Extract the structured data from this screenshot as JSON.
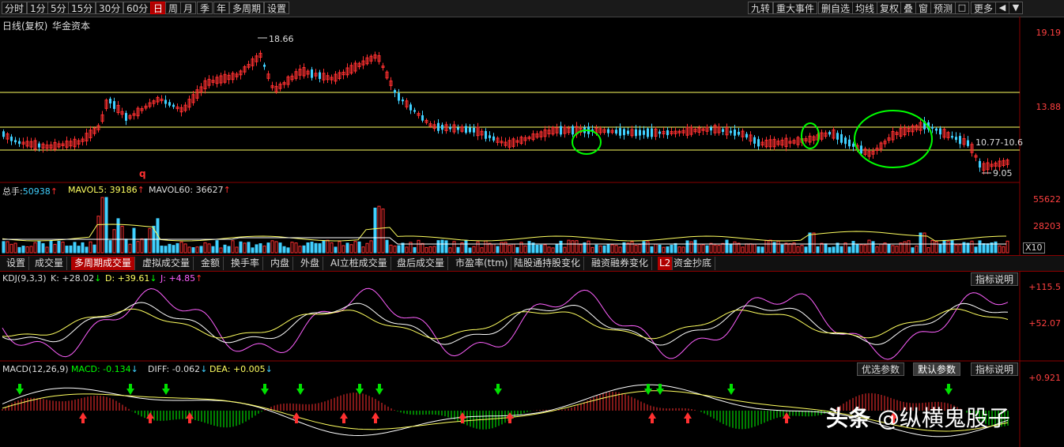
{
  "toolbar": {
    "left": [
      "分时",
      "1分",
      "5分",
      "15分",
      "30分",
      "60分",
      "日",
      "周",
      "月",
      "季",
      "年",
      "多周期",
      "设置"
    ],
    "active": "日",
    "right": [
      "九转",
      "重大事件",
      "删自选",
      "均线",
      "复权",
      "叠",
      "窗",
      "预测"
    ],
    "more": "更多"
  },
  "price_panel": {
    "title": "日线(复权)",
    "stock": "华金资本",
    "high_label": "18.66",
    "low_label": "9.05",
    "range_label": "10.77-10.6",
    "mark": "q",
    "axis": [
      "19.19",
      "13.88"
    ],
    "colors": {
      "up": "#ff3030",
      "down": "#40d0ff",
      "level": "#ffff60",
      "circle": "#00ff00"
    }
  },
  "volume_panel": {
    "label": "总手:",
    "total": "50938",
    "mavol5_label": "MAVOL5:",
    "mavol5": "39186",
    "mavol60_label": "MAVOL60:",
    "mavol60": "36627",
    "axis": [
      "55622",
      "28203"
    ],
    "unit": "X10"
  },
  "tabs": [
    "设置",
    "成交量",
    "多周期成交量",
    "虚拟成交量",
    "金额",
    "换手率",
    "内盘",
    "外盘",
    "AI立桩成交量",
    "盘后成交量",
    "市盈率(ttm)",
    "陆股通持股变化",
    "融资融券变化",
    "资金抄底"
  ],
  "tabs_active": "多周期成交量",
  "tabs_badge": "L2",
  "kdj": {
    "label": "KDJ(9,3,3)",
    "k": "K: +28.02",
    "d": "D: +39.61",
    "j": "J: +4.85",
    "axis": [
      "+115.5",
      "+52.07"
    ],
    "button": "指标说明"
  },
  "macd": {
    "label": "MACD(12,26,9)",
    "macd": "MACD: -0.134",
    "diff": "DIFF: -0.062",
    "dea": "DEA: +0.005",
    "axis": [
      "+0.921"
    ],
    "buttons": [
      "优选参数",
      "默认参数",
      "指标说明"
    ]
  },
  "watermark": {
    "brand": "头条",
    "author": "@纵横鬼股子"
  }
}
